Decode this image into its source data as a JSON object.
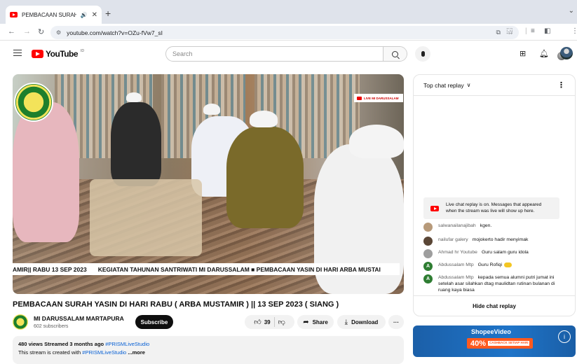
{
  "browser": {
    "tab_title": "PEMBACAAN SURAH YAS",
    "new_tab": "+",
    "url": "youtube.com/watch?v=OZu-fVw7_sI"
  },
  "header": {
    "logo_text": "YouTube",
    "logo_region": "ID",
    "search_placeholder": "Search"
  },
  "video": {
    "live_badge": "LIVE MI DARUSSALAM",
    "ticker_left": "AMIR|| RABU 13 SEP 2023",
    "ticker_right": "KEGIATAN TAHUNAN SANTRIWATI MI DARUSSALAM ■ PEMBACAAN YASIN DI HARI ARBA MUSTAI"
  },
  "meta": {
    "title": "PEMBACAAN SURAH YASIN DI HARI RABU ( ARBA MUSTAMIR ) || 13 SEP 2023 ( SIANG )",
    "channel": "MI DARUSSALAM MARTAPURA",
    "subscribers": "602 subscribers",
    "subscribe": "Subscribe",
    "likes": "39",
    "share": "Share",
    "download": "Download",
    "more": "···",
    "desc_stats": "480 views  Streamed 3 months ago",
    "desc_tag": "#PRISMLiveStudio",
    "desc_line2_prefix": "This stream is created with ",
    "desc_line2_link": "#PRISMLiveStudio",
    "desc_more": " ...more"
  },
  "chat": {
    "title": "Top chat replay",
    "notice": "Live chat replay is on. Messages that appeared when the stream was live will show up here.",
    "messages": [
      {
        "author": "salwanailanajibah",
        "text": "kgen.",
        "avatar_color": "#b79a7a",
        "initial": ""
      },
      {
        "author": "nailufar galery",
        "text": "mojokerto hadir menyimak",
        "avatar_color": "#5a4636",
        "initial": ""
      },
      {
        "author": "Ahmad hr Youtube",
        "text": "Guru salam guru idola",
        "avatar_color": "#9e9e9e",
        "initial": ""
      },
      {
        "author": "Abdussalam Mtp",
        "text": "Guru Rofiqi",
        "avatar_color": "#2e7d32",
        "initial": "A"
      },
      {
        "author": "Abdussalam Mtp",
        "text": "kepada semua alumni putri jumat ini setelah asar silahkan dtag maulidtan rutinan bulanan di ruang kaya biasa",
        "avatar_color": "#2e7d32",
        "initial": "A"
      }
    ],
    "hide": "Hide chat replay"
  },
  "ad": {
    "brand": "ShopeeVideo",
    "promo": "40%",
    "promo_sub": "CASHBACK SETIAP HARI",
    "info": "i"
  }
}
